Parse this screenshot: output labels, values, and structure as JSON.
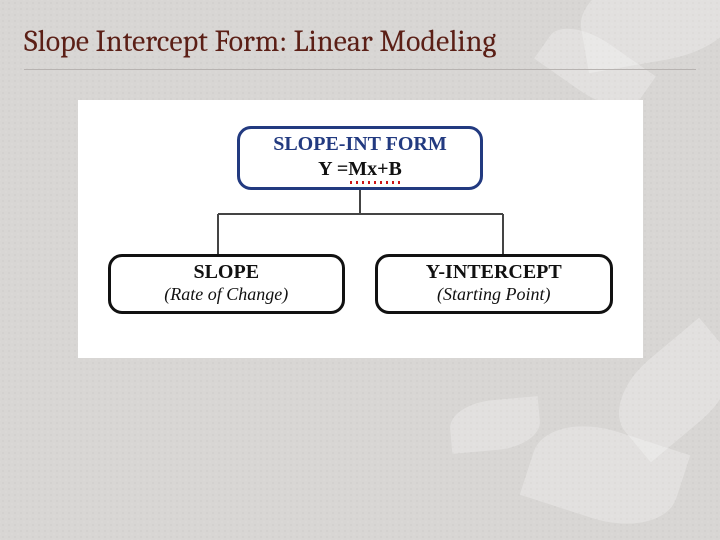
{
  "title": "Slope Intercept Form: Linear Modeling",
  "diagram": {
    "top": {
      "heading": "SLOPE-INT FORM",
      "formula_plain": "Y =",
      "formula_underlined": "Mx+B"
    },
    "left": {
      "label": "SLOPE",
      "sub": "(Rate of Change)"
    },
    "right": {
      "label": "Y-INTERCEPT",
      "sub": "(Starting Point)"
    }
  }
}
